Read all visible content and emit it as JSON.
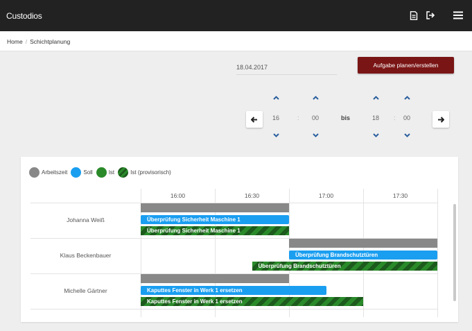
{
  "app": {
    "title": "Custodios"
  },
  "header_icons": [
    "document-icon",
    "sign-out-icon",
    "menu-icon"
  ],
  "breadcrumb": {
    "home": "Home",
    "separator": "/",
    "current": "Schichtplanung"
  },
  "toolbar": {
    "date": "18.04.2017",
    "create_task_label": "Aufgabe planen/erstellen"
  },
  "time_range": {
    "from_hour": "16",
    "from_minute": "00",
    "separator": ":",
    "bis_label": "bis",
    "to_hour": "18",
    "to_minute": "00"
  },
  "legend": [
    {
      "label": "Arbeitszeit",
      "color": "#888888"
    },
    {
      "label": "Soll",
      "color": "#1a9ef0"
    },
    {
      "label": "Ist",
      "color": "#2a8a2a"
    },
    {
      "label": "Ist (provisorisch)",
      "color": "#1d5a1d"
    }
  ],
  "schedule": {
    "time_columns": [
      "16:00",
      "16:30",
      "17:00",
      "17:30"
    ],
    "rows": [
      {
        "person": "Johanna Weiß",
        "arbeitszeit": {
          "start": "16:00",
          "end": "17:00"
        },
        "soll": {
          "label": "Überprüfung Sicherheit Maschine 1",
          "start": "16:00",
          "end": "17:00"
        },
        "ist": {
          "label": "Überprüfung Sicherheit Maschine 1",
          "start": "16:00",
          "end": "17:00",
          "provisorisch": true
        }
      },
      {
        "person": "Klaus Beckenbauer",
        "arbeitszeit": {
          "start": "17:00",
          "end": "18:00"
        },
        "soll": {
          "label": "Überprüfung Brandschutztüren",
          "start": "17:00",
          "end": "18:00"
        },
        "ist": {
          "label": "Überprüfung Brandschutztüren",
          "start": "16:45",
          "end": "18:00",
          "provisorisch": true
        }
      },
      {
        "person": "Michelle Gärtner",
        "arbeitszeit": {
          "start": "16:00",
          "end": "17:00"
        },
        "soll": {
          "label": "Kaputtes Fenster in Werk 1 ersetzen",
          "start": "16:00",
          "end": "17:15"
        },
        "ist": {
          "label": "Kaputtes Fenster in Werk 1 ersetzen",
          "start": "16:00",
          "end": "17:30",
          "provisorisch": true
        }
      }
    ]
  }
}
